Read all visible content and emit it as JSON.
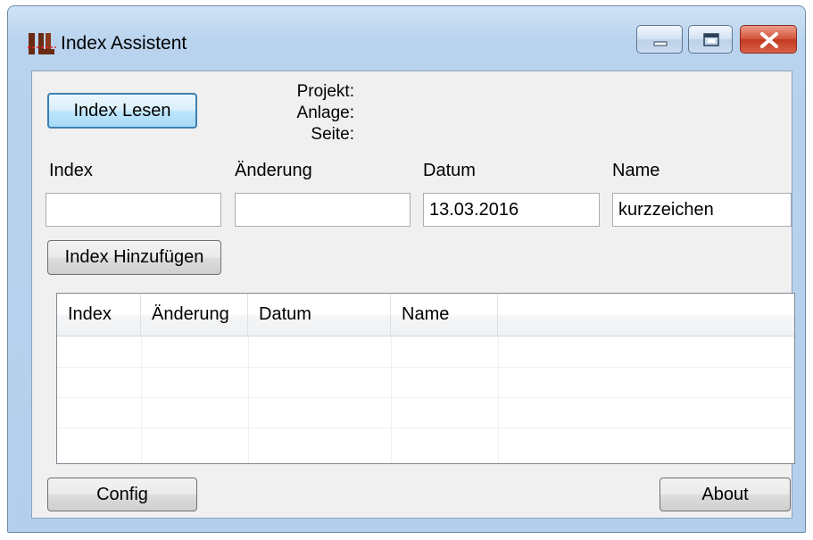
{
  "window": {
    "title": "Index Assistent",
    "icon": "app-logo-icon",
    "controls": {
      "minimize_icon": "minimize-icon",
      "maximize_icon": "maximize-icon",
      "close_icon": "close-icon"
    }
  },
  "actions": {
    "read_index_label": "Index Lesen",
    "add_index_label": "Index Hinzufügen",
    "config_label": "Config",
    "about_label": "About"
  },
  "info": {
    "project_label": "Projekt:",
    "plant_label": "Anlage:",
    "page_label": "Seite:"
  },
  "form": {
    "index_label": "Index",
    "index_value": "",
    "change_label": "Änderung",
    "change_value": "",
    "date_label": "Datum",
    "date_value": "13.03.2016",
    "name_label": "Name",
    "name_value": "kurzzeichen"
  },
  "table": {
    "columns": [
      "Index",
      "Änderung",
      "Datum",
      "Name"
    ],
    "rows": []
  },
  "colors": {
    "window_frame": "#b9d3ee",
    "client_bg": "#f0f0f0",
    "close_button": "#c23a20",
    "focus_border": "#3c7fb1"
  }
}
